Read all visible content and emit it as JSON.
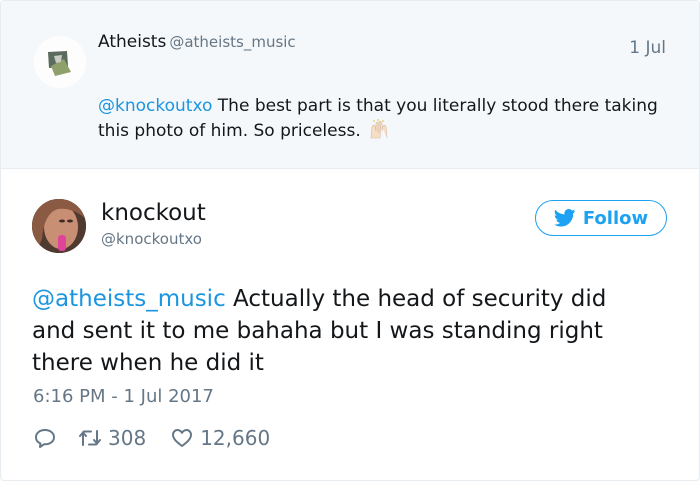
{
  "reply": {
    "display_name": "Atheists",
    "handle": "@atheists_music",
    "date": "1 Jul",
    "mention": "@knockoutxo",
    "text": " The best part is that you literally stood there taking this photo of him. So priceless.",
    "emoji_icon": "raised-hands-icon"
  },
  "tweet": {
    "display_name": "knockout",
    "handle": "@knockoutxo",
    "follow_label": "Follow",
    "mention": "@atheists_music",
    "text": " Actually the head of security did and sent it to me bahaha but I was standing right there when he did it",
    "timestamp": "6:16 PM - 1 Jul 2017",
    "retweets": "308",
    "likes": "12,660"
  },
  "colors": {
    "link": "#1b95e0",
    "follow": "#1da1f2",
    "muted": "#657786",
    "reply_bg": "#f5f8fa"
  },
  "icons": [
    "reply-icon",
    "retweet-icon",
    "like-icon",
    "twitter-bird-icon"
  ]
}
